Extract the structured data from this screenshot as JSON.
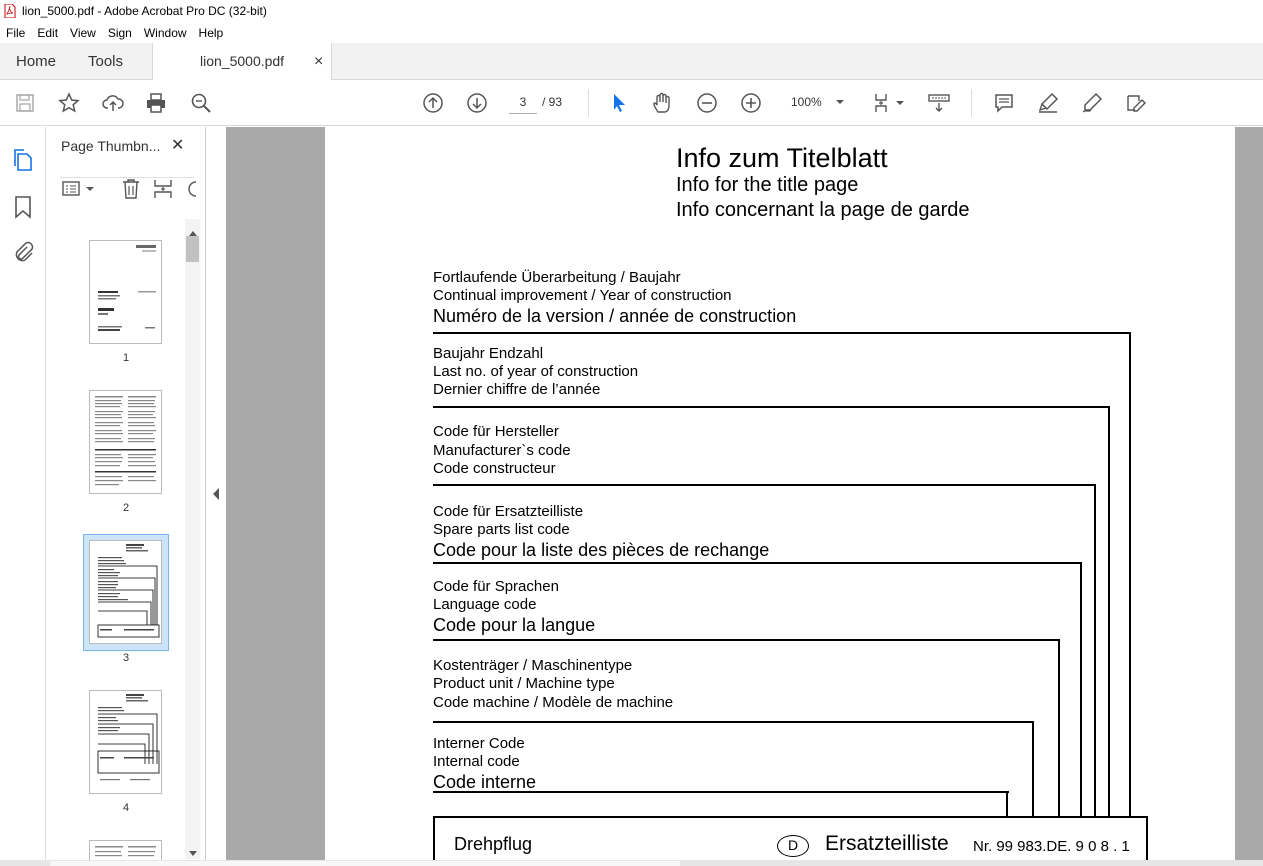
{
  "window": {
    "title": "lion_5000.pdf - Adobe Acrobat Pro DC (32-bit)"
  },
  "menu": [
    "File",
    "Edit",
    "View",
    "Sign",
    "Window",
    "Help"
  ],
  "tabs": {
    "home": "Home",
    "tools": "Tools",
    "document": "lion_5000.pdf",
    "close_glyph": "×"
  },
  "toolbar": {
    "current_page": "3",
    "page_total": "/ 93",
    "zoom": "100%"
  },
  "thumbnails": {
    "title": "Page Thumbn...",
    "close_glyph": "✕",
    "pages": [
      "1",
      "2",
      "3",
      "4"
    ],
    "selected": "3"
  },
  "document": {
    "title_de": "Info  zum  Titelblatt",
    "title_en": "Info for the title page",
    "title_fr": "Info concernant la page de garde",
    "sections": [
      {
        "de": "Fortlaufende Überarbeitung / Baujahr",
        "en": "Continual improvement / Year of construction",
        "fr": "Numéro de la version / année de construction"
      },
      {
        "de": "Baujahr Endzahl",
        "en": "Last no. of year of construction",
        "fr": "Dernier chiffre de l’année"
      },
      {
        "de": "Code für Hersteller",
        "en": "Manufacturer`s  code",
        "fr": "Code constructeur"
      },
      {
        "de": "Code für Ersatzteilliste",
        "en": "Spare parts list code",
        "fr": "Code pour la liste des pièces de rechange"
      },
      {
        "de": "Code für Sprachen",
        "en": "Language code",
        "fr": "Code pour la langue"
      },
      {
        "de": "Kostenträger / Maschinentype",
        "en": "Product unit / Machine type",
        "fr": "Code machine / Modèle de machine"
      },
      {
        "de": "Interner Code",
        "en": "Internal code",
        "fr": "Code interne"
      }
    ],
    "box": {
      "left": "Drehpflug",
      "circle": "D",
      "middle": "Ersatzteilliste",
      "number": "Nr. 99 983.DE. 9 0 8 . 1"
    }
  }
}
